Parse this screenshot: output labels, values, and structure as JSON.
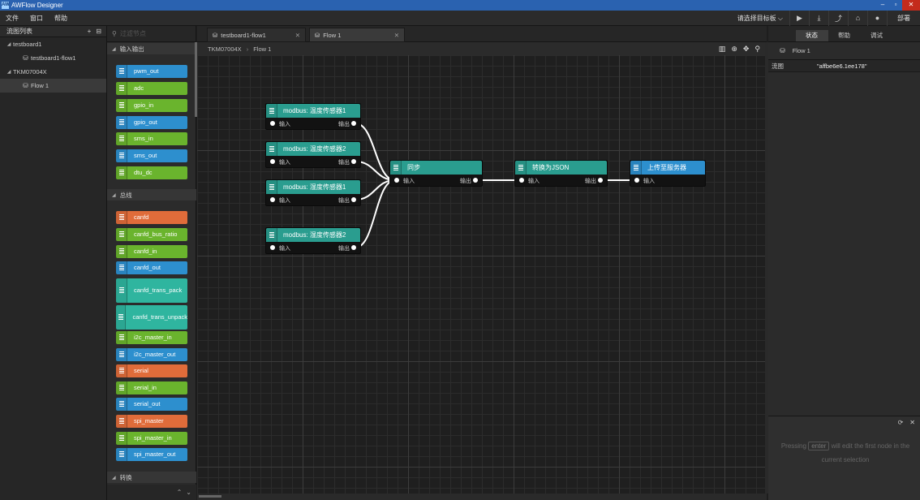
{
  "window": {
    "title": "AWFlow Designer",
    "icon_label": "AW"
  },
  "menu": {
    "items": [
      "文件",
      "窗口",
      "帮助"
    ],
    "target_select": "请选择目标板",
    "deploy": "部署"
  },
  "sidebar": {
    "title": "流图列表",
    "tree": [
      {
        "label": "testboard1",
        "level": 0,
        "expanded": true
      },
      {
        "label": "testboard1-flow1",
        "level": 1
      },
      {
        "label": "TKM07004X",
        "level": 0,
        "expanded": true
      },
      {
        "label": "Flow 1",
        "level": 1,
        "selected": true
      }
    ]
  },
  "palette": {
    "search_placeholder": "过滤节点",
    "categories": [
      "输入输出",
      "总线",
      "转换"
    ],
    "io_nodes": [
      {
        "label": "pwm_out",
        "color": "#2d8fce"
      },
      {
        "label": "adc",
        "color": "#6ab42d"
      },
      {
        "label": "gpio_in",
        "color": "#6ab42d"
      },
      {
        "label": "gpio_out",
        "color": "#2d8fce"
      },
      {
        "label": "sms_in",
        "color": "#6ab42d"
      },
      {
        "label": "sms_out",
        "color": "#2d8fce"
      },
      {
        "label": "dtu_dc",
        "color": "#6ab42d"
      }
    ],
    "bus_nodes": [
      {
        "label": "canfd",
        "color": "#e06c3a"
      },
      {
        "label": "canfd_bus_ratio",
        "color": "#6ab42d"
      },
      {
        "label": "canfd_in",
        "color": "#6ab42d"
      },
      {
        "label": "canfd_out",
        "color": "#2d8fce"
      },
      {
        "label": "canfd_trans_pack",
        "color": "#2fb59f",
        "tall": true
      },
      {
        "label": "canfd_trans_unpack",
        "color": "#2fb59f",
        "tall": true
      },
      {
        "label": "i2c_master_in",
        "color": "#6ab42d"
      },
      {
        "label": "i2c_master_out",
        "color": "#2d8fce"
      },
      {
        "label": "serial",
        "color": "#e06c3a"
      },
      {
        "label": "serial_in",
        "color": "#6ab42d"
      },
      {
        "label": "serial_out",
        "color": "#2d8fce"
      },
      {
        "label": "spi_master",
        "color": "#e06c3a"
      },
      {
        "label": "spi_master_in",
        "color": "#6ab42d"
      },
      {
        "label": "spi_master_out",
        "color": "#2d8fce"
      }
    ]
  },
  "tabs": [
    {
      "label": "testboard1-flow1",
      "active": false
    },
    {
      "label": "Flow 1",
      "active": true
    }
  ],
  "breadcrumb": {
    "parts": [
      "TKM07004X",
      "Flow 1"
    ]
  },
  "flow": {
    "nodes": [
      {
        "id": "n1",
        "label": "modbus: 温度传感器1",
        "in": "输入",
        "out": "输出",
        "color": "#2a9d8f"
      },
      {
        "id": "n2",
        "label": "modbus: 温度传感器2",
        "in": "输入",
        "out": "输出",
        "color": "#2a9d8f"
      },
      {
        "id": "n3",
        "label": "modbus: 湿度传感器1",
        "in": "输入",
        "out": "输出",
        "color": "#2a9d8f"
      },
      {
        "id": "n4",
        "label": "modbus: 湿度传感器2",
        "in": "输入",
        "out": "输出",
        "color": "#2a9d8f"
      },
      {
        "id": "n5",
        "label": "同步",
        "in": "输入",
        "out": "输出",
        "color": "#2a9d8f"
      },
      {
        "id": "n6",
        "label": "转换为JSON",
        "in": "输入",
        "out": "输出",
        "color": "#2a9d8f"
      },
      {
        "id": "n7",
        "label": "上传至服务器",
        "in": "输入",
        "out": "",
        "color": "#2d8fce"
      }
    ],
    "links": [
      [
        "n1",
        "n5"
      ],
      [
        "n2",
        "n5"
      ],
      [
        "n3",
        "n5"
      ],
      [
        "n4",
        "n5"
      ],
      [
        "n5",
        "n6"
      ],
      [
        "n6",
        "n7"
      ]
    ]
  },
  "right": {
    "tabs": [
      "状态",
      "帮助",
      "调试"
    ],
    "flow_name": "Flow 1",
    "prop_key": "流图",
    "prop_value": "\"affbe6e6.1ee178\"",
    "hint_before": "Pressing",
    "hint_key": "enter",
    "hint_after": "will edit the first node in the current selection"
  }
}
